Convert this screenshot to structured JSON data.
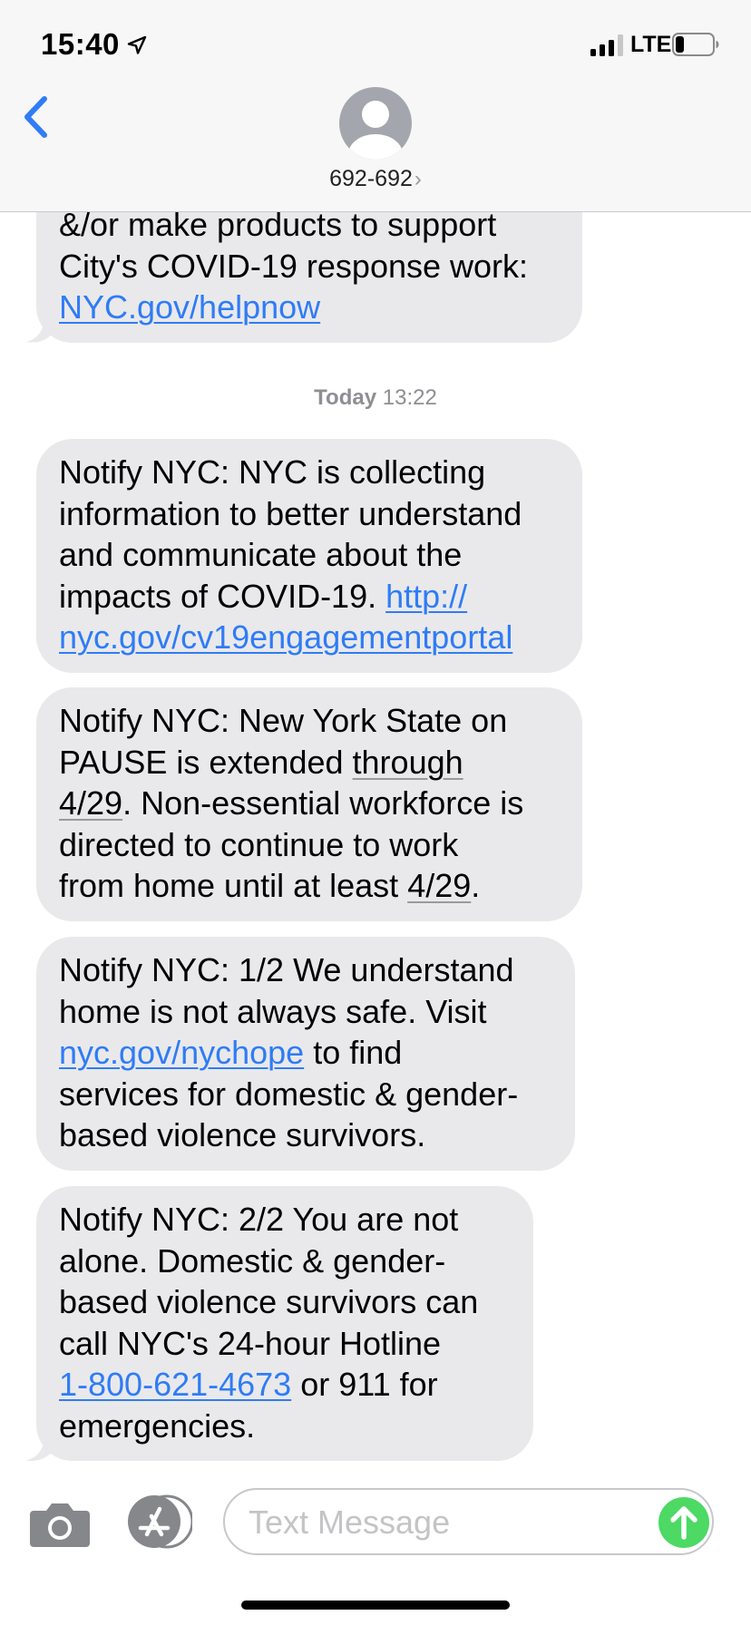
{
  "status_bar": {
    "time": "15:40",
    "network": "LTE",
    "location_icon": "location-arrow-icon",
    "signal_icon": "signal-bars-icon",
    "battery_icon": "battery-low-icon"
  },
  "header": {
    "back_icon": "chevron-left-icon",
    "avatar_icon": "person-icon",
    "contact_name": "692-692",
    "contact_chevron": "›"
  },
  "messages": {
    "m0": {
      "l1": "&/or make products to support",
      "l2": "City's COVID-19 response work:",
      "link": "NYC.gov/helpnow"
    },
    "timestamp": {
      "day": "Today",
      "time": "13:22"
    },
    "m1": {
      "l1": "Notify NYC: NYC is collecting",
      "l2": "information to better understand",
      "l3": "and communicate about the",
      "l4": "impacts of COVID-19.",
      "link1": "http://",
      "link2": "nyc.gov/cv19engagementportal"
    },
    "m2": {
      "l1": "Notify NYC: New York State on",
      "l2a": "PAUSE is extended",
      "d1": "through",
      "d2": "4/29",
      "l3b": ". Non-essential workforce is",
      "l4": "directed to continue to work",
      "l5a": "from home until at least",
      "d3": "4/29",
      "l5b": "."
    },
    "m3": {
      "l1": "Notify NYC: 1/2 We understand",
      "l2": "home is not always safe.  Visit",
      "link": "nyc.gov/nychope",
      "l3b": "to find",
      "l4": "services for domestic & gender-",
      "l5": "based violence survivors."
    },
    "m4": {
      "l1": "Notify NYC: 2/2 You are not",
      "l2": "alone. Domestic & gender-",
      "l3": "based violence survivors can",
      "l4": "call NYC's 24-hour Hotline",
      "link": "1-800-621-4673",
      "l5b": "or 911 for",
      "l6": "emergencies."
    }
  },
  "input_bar": {
    "camera_icon": "camera-icon",
    "appstore_icon": "app-store-icon",
    "placeholder": "Text Message",
    "value": "",
    "send_icon": "send-arrow-up-icon",
    "send_color": "#4cd964"
  },
  "colors": {
    "bubble_received": "#e9e9eb",
    "link": "#2f7cf6",
    "ios_blue": "#2f7cf6",
    "header_bg": "#f7f7f7"
  }
}
